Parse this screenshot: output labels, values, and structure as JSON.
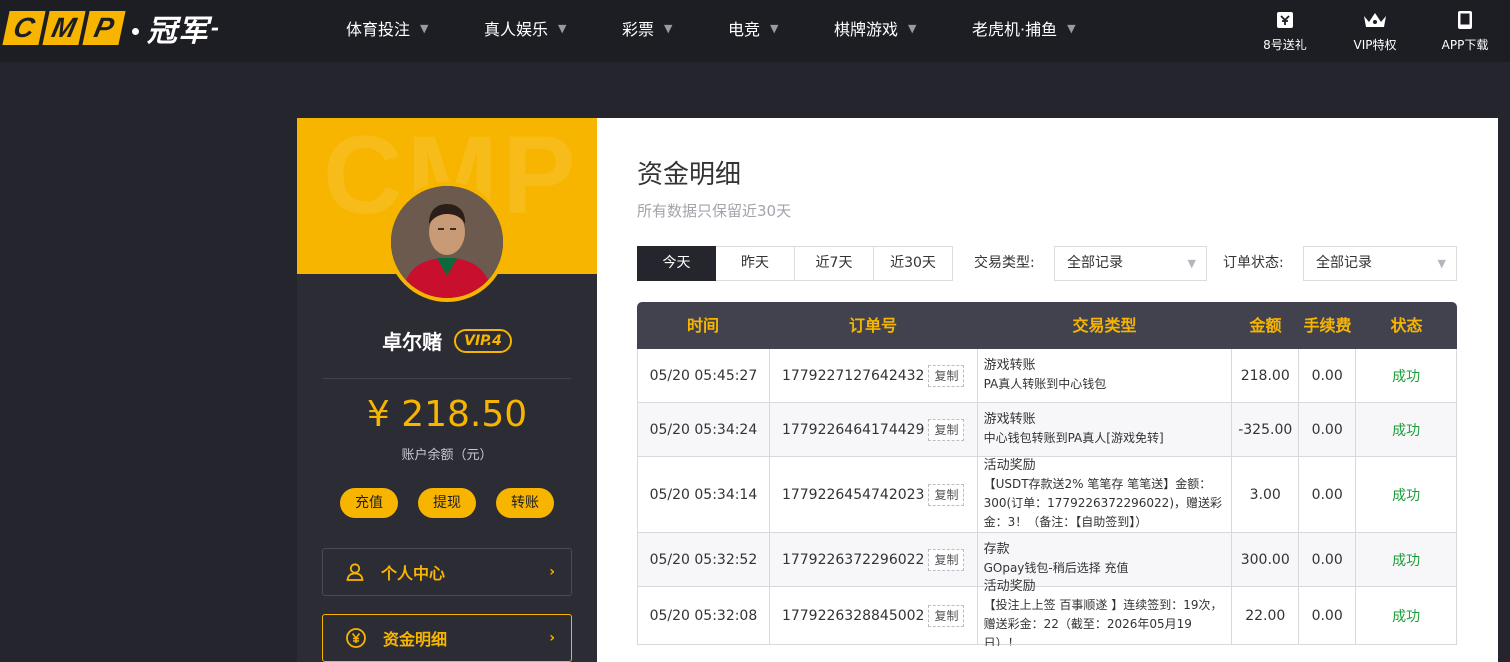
{
  "logo": {
    "letters": [
      "C",
      "M",
      "P"
    ],
    "cn": "冠军",
    "tail": "-"
  },
  "nav": {
    "items": [
      {
        "label": "体育投注"
      },
      {
        "label": "真人娱乐"
      },
      {
        "label": "彩票"
      },
      {
        "label": "电竞"
      },
      {
        "label": "棋牌游戏"
      },
      {
        "label": "老虎机·捕鱼"
      }
    ],
    "right": [
      {
        "label": "8号送礼",
        "icon": "gift-icon"
      },
      {
        "label": "VIP特权",
        "icon": "crown-icon"
      },
      {
        "label": "APP下载",
        "icon": "phone-icon"
      }
    ]
  },
  "profile": {
    "watermark": "CMP",
    "username": "卓尔赌",
    "vip": "VIP.4",
    "balance": "¥ 218.50",
    "balance_label": "账户余额（元）",
    "actions": {
      "deposit": "充值",
      "withdraw": "提现",
      "transfer": "转账"
    },
    "menu": {
      "personal": "个人中心",
      "funds": "资金明细"
    }
  },
  "page": {
    "title": "资金明细",
    "subtitle": "所有数据只保留近30天",
    "range_tabs": [
      "今天",
      "昨天",
      "近7天",
      "近30天"
    ],
    "active_tab": 0,
    "filters": {
      "type_label": "交易类型:",
      "type_value": "全部记录",
      "status_label": "订单状态:",
      "status_value": "全部记录"
    }
  },
  "table": {
    "headers": [
      "时间",
      "订单号",
      "交易类型",
      "金额",
      "手续费",
      "状态"
    ],
    "copy_label": "复制",
    "rows": [
      {
        "time": "05/20 05:45:27",
        "order": "1779227127642432",
        "type": "游戏转账",
        "desc": "PA真人转账到中心钱包",
        "amount": "218.00",
        "fee": "0.00",
        "status": "成功"
      },
      {
        "time": "05/20 05:34:24",
        "order": "1779226464174429",
        "type": "游戏转账",
        "desc": "中心钱包转账到PA真人[游戏免转]",
        "amount": "-325.00",
        "fee": "0.00",
        "status": "成功"
      },
      {
        "time": "05/20 05:34:14",
        "order": "1779226454742023",
        "type": "活动奖励",
        "desc": "【USDT存款送2% 笔笔存 笔笔送】金额：300(订单：1779226372296022)，赠送彩金：3！（备注：【自助签到】）",
        "amount": "3.00",
        "fee": "0.00",
        "status": "成功"
      },
      {
        "time": "05/20 05:32:52",
        "order": "1779226372296022",
        "type": "存款",
        "desc": "GOpay钱包-稍后选择 充值",
        "amount": "300.00",
        "fee": "0.00",
        "status": "成功"
      },
      {
        "time": "05/20 05:32:08",
        "order": "1779226328845002",
        "type": "活动奖励",
        "desc": "【投注上上签 百事顺遂 】连续签到：19次，赠送彩金：22（截至：2026年05月19日）！",
        "amount": "22.00",
        "fee": "0.00",
        "status": "成功"
      }
    ]
  },
  "colors": {
    "accent": "#f7b500",
    "dark": "#25252e",
    "success": "#1e9e3a"
  }
}
